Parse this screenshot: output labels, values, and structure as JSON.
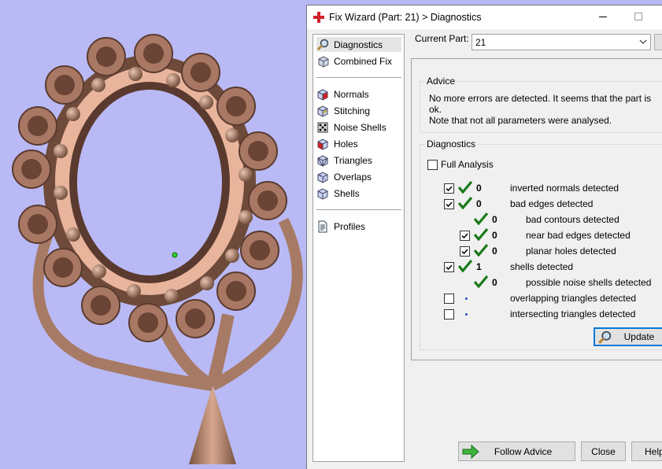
{
  "window": {
    "title": "Fix Wizard (Part: 21) > Diagnostics"
  },
  "nav": {
    "items": [
      {
        "label": "Diagnostics",
        "icon": "magnifier-icon"
      },
      {
        "label": "Combined Fix",
        "icon": "combined-fix-icon"
      },
      {
        "label": "Normals",
        "icon": "normals-cube-icon"
      },
      {
        "label": "Stitching",
        "icon": "stitching-cube-icon"
      },
      {
        "label": "Noise Shells",
        "icon": "noise-shells-icon"
      },
      {
        "label": "Holes",
        "icon": "holes-cube-icon"
      },
      {
        "label": "Triangles",
        "icon": "triangles-cube-icon"
      },
      {
        "label": "Overlaps",
        "icon": "overlaps-cube-icon"
      },
      {
        "label": "Shells",
        "icon": "shells-cube-icon"
      },
      {
        "label": "Profiles",
        "icon": "profiles-document-icon"
      }
    ]
  },
  "current_part": {
    "label": "Current Part:",
    "value": "21"
  },
  "advice": {
    "title": "Advice",
    "line1": "No more errors are detected. It seems that the part is ok.",
    "line2": "Note that not all parameters were analysed."
  },
  "diagnostics": {
    "title": "Diagnostics",
    "full_analysis": "Full Analysis",
    "rows": [
      {
        "count": "0",
        "text": "inverted normals detected"
      },
      {
        "count": "0",
        "text": "bad edges detected"
      },
      {
        "count": "0",
        "text": "bad contours detected"
      },
      {
        "count": "0",
        "text": "near bad edges detected"
      },
      {
        "count": "0",
        "text": "planar holes detected"
      },
      {
        "count": "1",
        "text": "shells detected"
      },
      {
        "count": "0",
        "text": "possible noise shells detected"
      },
      {
        "count": "",
        "text": "overlapping triangles detected"
      },
      {
        "count": "",
        "text": "intersecting triangles detected"
      }
    ]
  },
  "buttons": {
    "update": "Update",
    "follow_advice": "Follow Advice",
    "close": "Close",
    "help": "Help"
  },
  "colors": {
    "model_copper": "#c89880",
    "viewport_bg": "#b9b9f5",
    "check_green": "#1a7a1a"
  }
}
